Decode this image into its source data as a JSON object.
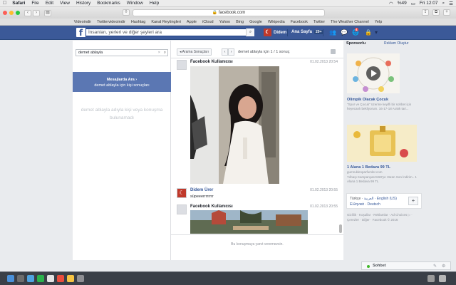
{
  "menubar": {
    "app": "Safari",
    "items": [
      "File",
      "Edit",
      "View",
      "History",
      "Bookmarks",
      "Window",
      "Help"
    ],
    "battery": "%49",
    "clock": "Fri 12:07"
  },
  "toolbar": {
    "url": "facebook.com"
  },
  "bookmarks": [
    "Videoindir",
    "Twittervideoindir",
    "Hashtag",
    "Kanal Reytingleri",
    "Apple",
    "iCloud",
    "Yahoo",
    "Bing",
    "Google",
    "Wikipedia",
    "Facebook",
    "Twitter",
    "The Weather Channel",
    "Yelp"
  ],
  "fb_header": {
    "logo": "f",
    "search_placeholder": "İnsanları, yerleri ve diğer şeyleri ara",
    "user_name": "Didem",
    "home_label": "Ana Sayfa",
    "home_count": "20+",
    "notif_badge": "4"
  },
  "left_panel": {
    "search_value": "demet ablayla",
    "msg_search_title": "Mesajlarda Ara ›",
    "msg_search_sub": "demet ablayla için kişi sonuçları",
    "empty_note": "demet ablayla adıyla kişi veya konuşma bulunamadı"
  },
  "conversation": {
    "back_label": "◂ Arama Sonuçları",
    "result_info": "demet ablayla için 1 / 1 sonuç",
    "messages": [
      {
        "sender": "Facebook Kullanıcısı",
        "time": "01.02.2013 20:54",
        "text": ""
      },
      {
        "sender": "Didem Ürer",
        "time": "01.02.2013 20:55",
        "text": "süpeeerrrrrrrr"
      },
      {
        "sender": "Facebook Kullanıcısı",
        "time": "01.02.2013 20:55",
        "text": ""
      }
    ],
    "footer_note": "Bu konuşmaya yanıt veremezsin."
  },
  "sidebar": {
    "sponsored": "Sponsorlu",
    "create_ad": "Reklam Oluştur",
    "ads": [
      {
        "title": "Olimpik Olacak Çocuk",
        "sub": "\"Spor ve Çocuk\" üzerine keyifli bir sohbet için heyecanlı bekliyorum. 16-17-18 Aralık tari..."
      },
      {
        "title": "1 Alana 1 Bedava 99 TL",
        "sub": "gumruklenparfumler.com",
        "sub2": "Yılbaşı Kampanyası%50'ye Varan Son İndirim.. 1 Alana 1 Bedava 99 TL"
      }
    ],
    "lang_current": "Türkçe ·",
    "lang_line1": "العربية · English (US)",
    "lang_line2": "Ελληνικά · Deutsch",
    "footer": "Gizlilik · Koşullar · Reklamlar · Ad Choices ▷ · Çerezler · Diğer · Facebook © 2016"
  },
  "chat": {
    "label": "Sohbet"
  },
  "colors": {
    "fb_blue": "#3b5998",
    "msg_search_bg": "#5b77b3",
    "link": "#365899"
  }
}
